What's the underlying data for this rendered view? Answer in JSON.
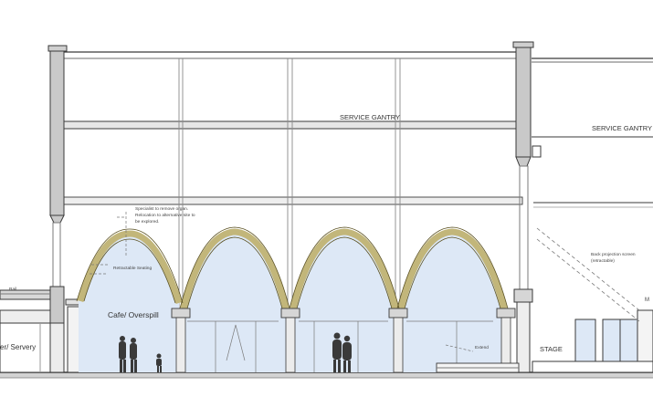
{
  "drawing": {
    "labels": {
      "service_gantry_main": "SERVICE GANTRY",
      "service_gantry_right": "SERVICE GANTRY",
      "cafe": "Cafe/ Overspill",
      "servery": "er/ Servery",
      "stage": "STAGE",
      "retractable_seating": "Retractable Seating",
      "relocation_note": "Specialist to remove organ. Relocation to alternative site to be explored.",
      "projection_note": "Back projection screen (retractable)",
      "extend_note": "Extend",
      "rail_note": "Rail",
      "right_edge_note": "M"
    },
    "colors": {
      "glazing": "#dde8f6",
      "stone_arch": "#d9cf9a",
      "column": "#c9c9c9",
      "line": "#3a3a3a",
      "faint_line": "#9a9a9a",
      "ground": "#bdbdbd"
    },
    "figures": [
      "person-pair-cafe",
      "child-cafe",
      "person-pair-hall"
    ]
  }
}
